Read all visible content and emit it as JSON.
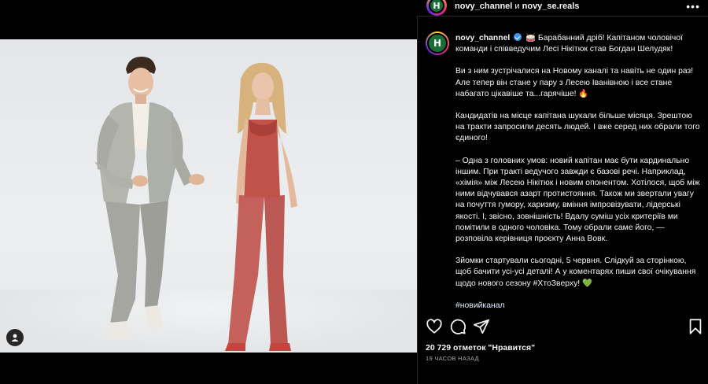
{
  "header": {
    "avatar_letter": "Н",
    "account": "novy_channel",
    "joiner": " и ",
    "collaborator": "novy_se.reals",
    "more_icon": "more-horizontal-icon"
  },
  "post": {
    "author": "novy_channel",
    "avatar_letter": "Н",
    "verified": true,
    "paragraphs": [
      "Барабанний дріб! Капітаном чоловічої команди і співведучим Лесі Нікітюк став Богдан Шелудяк!",
      "Ви з ним зустрічалися на Новому каналі та навіть не один раз! Але тепер він стане у пару з Лесею Іванівною і все стане набагато цікавіше та...гарячіше!",
      "Кандидатів на місце капітана шукали більше місяця. Зрештою на тракти запросили десять людей. І вже серед них обрали того єдиного!",
      "– Одна з головних умов: новий капітан має бути кардинально іншим. При тракті ведучого завжди є базові речі. Наприклад, «хімія» між Лесею Нікітюк і новим опонентом. Хотілося, щоб між ними відчувався азарт протистояння. Також ми звертали увагу на почуття гумору, харизму, вміння імпровізувати, лідерські якості. І, звісно, зовнішність! Вдалу суміш усіх критеріїв ми помітили в одного чоловіка. Тому обрали саме його, — розповіла керівниця проєкту Анна Вовк.",
      "Зйомки стартували сьогодні, 5 червня. Слідкуй за сторінкою, щоб бачити усі-усі деталі! А у коментарях пиши свої очікування щодо нового сезону #ХтоЗверху!"
    ],
    "hashtag": "#новийканал",
    "likes": "20 729 отметок \"Нравится\"",
    "timestamp": "19 ЧАСОВ НАЗАД"
  },
  "colors": {
    "background": "#000000",
    "text": "#f5f5f5",
    "muted": "#a8a8a8",
    "verified": "#3897f0",
    "brand_green": "#1a6d35"
  },
  "icons": [
    "heart-icon",
    "comment-icon",
    "share-icon",
    "bookmark-icon",
    "tag-person-icon",
    "fire-emoji",
    "green-heart-emoji",
    "drum-emoji"
  ]
}
